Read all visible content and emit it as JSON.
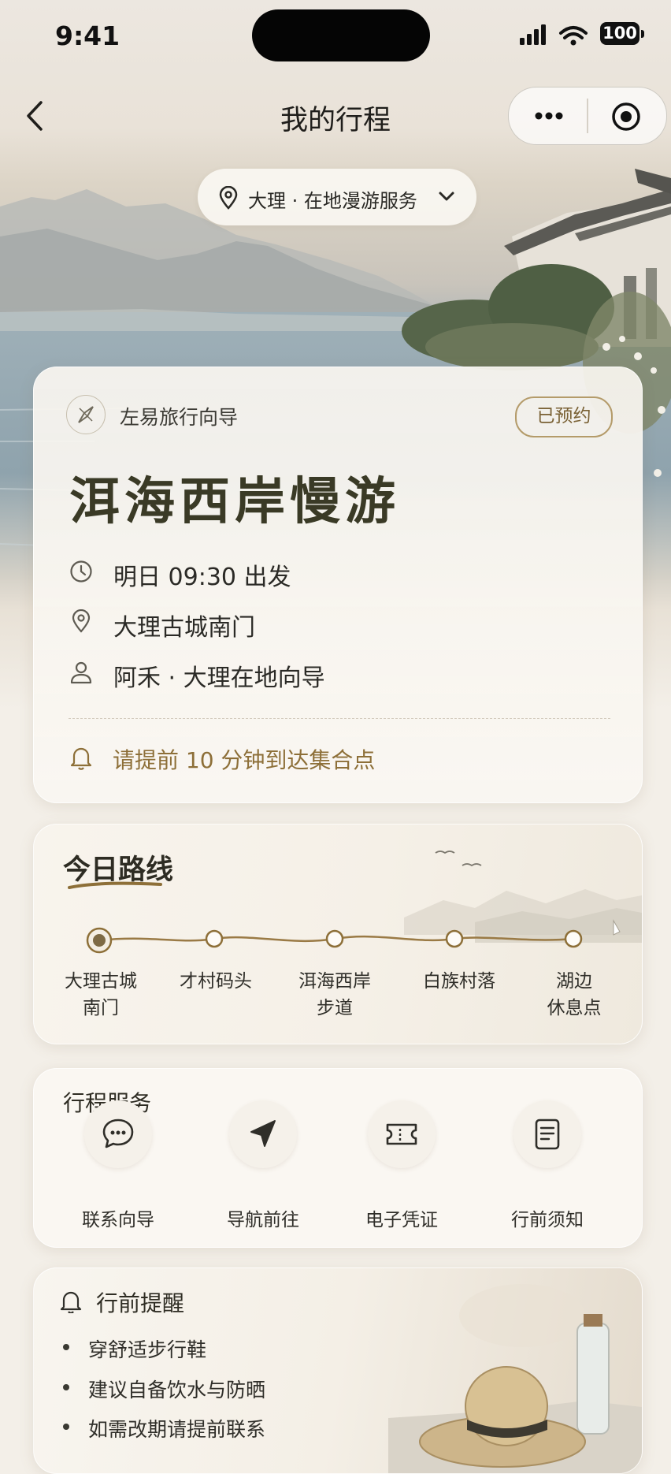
{
  "status_bar": {
    "time": "9:41",
    "battery": "100"
  },
  "nav": {
    "title": "我的行程"
  },
  "location": {
    "label": "大理 · 在地漫游服务"
  },
  "trip": {
    "brand": "左易旅行向导",
    "badge": "已预约",
    "title": "洱海西岸慢游",
    "departure": "明日 09:30 出发",
    "meeting_point": "大理古城南门",
    "guide": "阿禾 · 大理在地向导",
    "reminder": "请提前 10 分钟到达集合点"
  },
  "route": {
    "title": "今日路线",
    "stops": [
      {
        "line1": "大理古城",
        "line2": "南门"
      },
      {
        "line1": "才村码头",
        "line2": ""
      },
      {
        "line1": "洱海西岸",
        "line2": "步道"
      },
      {
        "line1": "白族村落",
        "line2": ""
      },
      {
        "line1": "湖边",
        "line2": "休息点"
      }
    ]
  },
  "services": {
    "title": "行程服务",
    "items": [
      {
        "label": "联系向导",
        "icon": "chat-icon"
      },
      {
        "label": "导航前往",
        "icon": "navigate-icon"
      },
      {
        "label": "电子凭证",
        "icon": "ticket-icon"
      },
      {
        "label": "行前须知",
        "icon": "notice-icon"
      }
    ]
  },
  "tips": {
    "title": "行前提醒",
    "items": [
      "穿舒适步行鞋",
      "建议自备饮水与防晒",
      "如需改期请提前联系"
    ]
  },
  "colors": {
    "accent": "#8d6f38",
    "badge_border": "#b49b6a",
    "title_dark": "#3a3a26"
  }
}
